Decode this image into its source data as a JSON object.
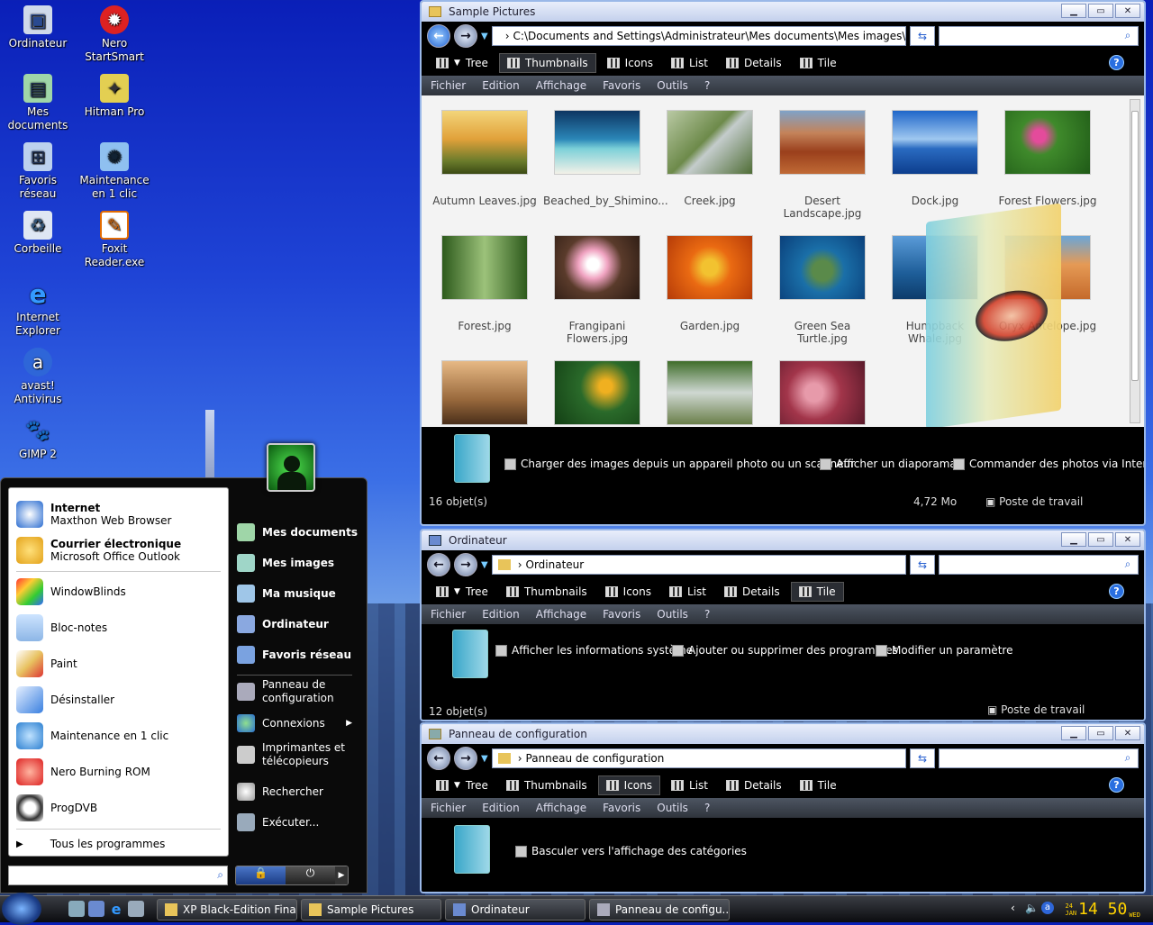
{
  "desktop": {
    "icons": [
      {
        "label": "Ordinateur"
      },
      {
        "label": "Nero StartSmart"
      },
      {
        "label": "Mes documents"
      },
      {
        "label": "Hitman Pro"
      },
      {
        "label": "Favoris réseau"
      },
      {
        "label": "Maintenance en 1 clic"
      },
      {
        "label": "Corbeille"
      },
      {
        "label": "Foxit Reader.exe"
      },
      {
        "label": "Internet Explorer"
      },
      {
        "label": "avast! Antivirus"
      },
      {
        "label": "GIMP 2"
      }
    ]
  },
  "toolbar": {
    "tree": "Tree",
    "thumbnails": "Thumbnails",
    "icons": "Icons",
    "list": "List",
    "details": "Details",
    "tile": "Tile"
  },
  "menu": {
    "fichier": "Fichier",
    "edition": "Edition",
    "affichage": "Affichage",
    "favoris": "Favoris",
    "outils": "Outils",
    "help": "?"
  },
  "win1": {
    "title": "Sample Pictures",
    "address": "C:\\Documents and Settings\\Administrateur\\Mes documents\\Mes images\\",
    "thumbnails": [
      {
        "label": "Autumn Leaves.jpg"
      },
      {
        "label": "Beached_by_Shimino..."
      },
      {
        "label": "Creek.jpg"
      },
      {
        "label": "Desert Landscape.jpg"
      },
      {
        "label": "Dock.jpg"
      },
      {
        "label": "Forest Flowers.jpg"
      },
      {
        "label": "Forest.jpg"
      },
      {
        "label": "Frangipani Flowers.jpg"
      },
      {
        "label": "Garden.jpg"
      },
      {
        "label": "Green Sea Turtle.jpg"
      },
      {
        "label": "Humpback Whale.jpg"
      },
      {
        "label": "Oryx Antelope.jpg"
      },
      {
        "label": ""
      },
      {
        "label": ""
      },
      {
        "label": ""
      },
      {
        "label": ""
      }
    ],
    "tasks": {
      "camera": "Charger des images depuis un appareil photo ou un scanneur",
      "slideshow": "Afficher un diaporama",
      "order": "Commander des photos via Internet"
    },
    "status": {
      "count": "16 objet(s)",
      "size": "4,72 Mo",
      "location": "Poste de travail"
    }
  },
  "win2": {
    "title": "Ordinateur",
    "address": "Ordinateur",
    "tasks": {
      "sysinfo": "Afficher les informations système",
      "programs": "Ajouter ou supprimer des programmes",
      "setting": "Modifier un paramètre"
    },
    "status": {
      "count": "12 objet(s)",
      "location": "Poste de travail"
    }
  },
  "win3": {
    "title": "Panneau de configuration",
    "address": "Panneau de configuration",
    "tasks": {
      "categories": "Basculer vers l'affichage des catégories"
    }
  },
  "startmenu": {
    "pinned": [
      {
        "title": "Internet",
        "sub": "Maxthon Web Browser"
      },
      {
        "title": "Courrier électronique",
        "sub": "Microsoft Office Outlook"
      }
    ],
    "recent": [
      "WindowBlinds",
      "Bloc-notes",
      "Paint",
      "Désinstaller",
      "Maintenance en 1 clic",
      "Nero Burning ROM",
      "ProgDVB"
    ],
    "all_programs": "Tous les programmes",
    "right": [
      "Mes documents",
      "Mes images",
      "Ma musique",
      "Ordinateur",
      "Favoris réseau",
      "Panneau de configuration",
      "Connexions",
      "Imprimantes et télécopieurs",
      "Rechercher",
      "Exécuter..."
    ]
  },
  "taskbar": {
    "buttons": [
      "XP Black-Edition Final",
      "Sample Pictures",
      "Ordinateur",
      "Panneau de configu..."
    ],
    "clock": {
      "day": "24",
      "month": "JAN",
      "time": "14 50",
      "weekday": "WED"
    }
  }
}
